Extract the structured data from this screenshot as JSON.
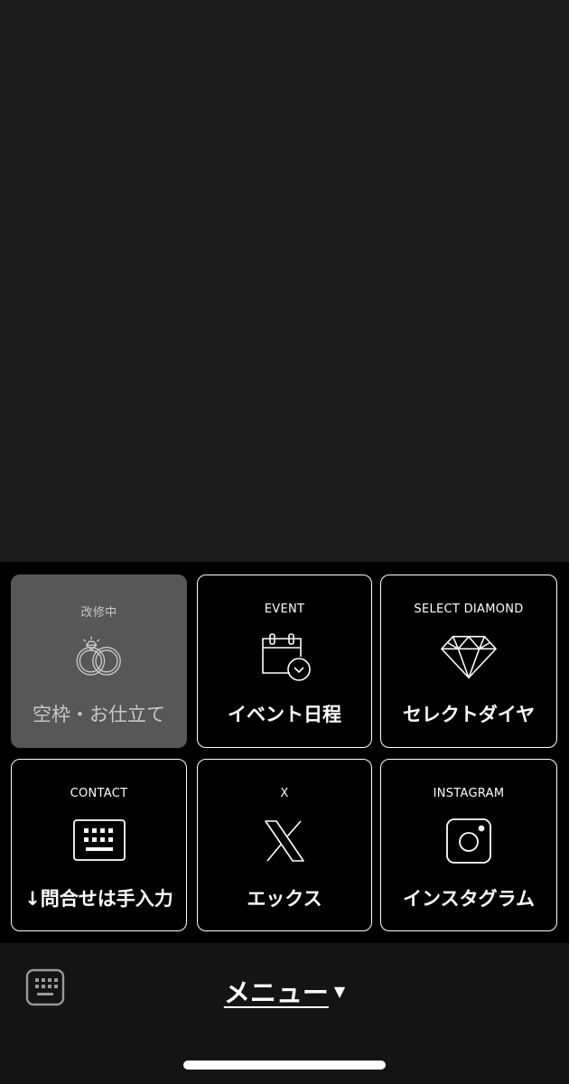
{
  "rich_menu": {
    "tiles": [
      {
        "caption": "改修中",
        "label": "空枠・お仕立て",
        "icon": "rings-icon",
        "enabled": false
      },
      {
        "caption": "EVENT",
        "label": "イベント日程",
        "icon": "calendar-clock-icon",
        "enabled": true
      },
      {
        "caption": "SELECT DIAMOND",
        "label": "セレクトダイヤ",
        "icon": "diamond-icon",
        "enabled": true
      },
      {
        "caption": "CONTACT",
        "label": "↓問合せは手入力",
        "icon": "keyboard-icon",
        "enabled": true
      },
      {
        "caption": "X",
        "label": "エックス",
        "icon": "x-logo-icon",
        "enabled": true
      },
      {
        "caption": "INSTAGRAM",
        "label": "インスタグラム",
        "icon": "instagram-icon",
        "enabled": true
      }
    ]
  },
  "bottom_bar": {
    "menu_label": "メニュー",
    "menu_caret": "▼",
    "keyboard_toggle_icon": "keyboard-icon"
  },
  "colors": {
    "chat_background": "#1b1b1b",
    "menu_background": "#000000",
    "disabled_tile": "#575757",
    "bottom_bar": "#141414"
  }
}
